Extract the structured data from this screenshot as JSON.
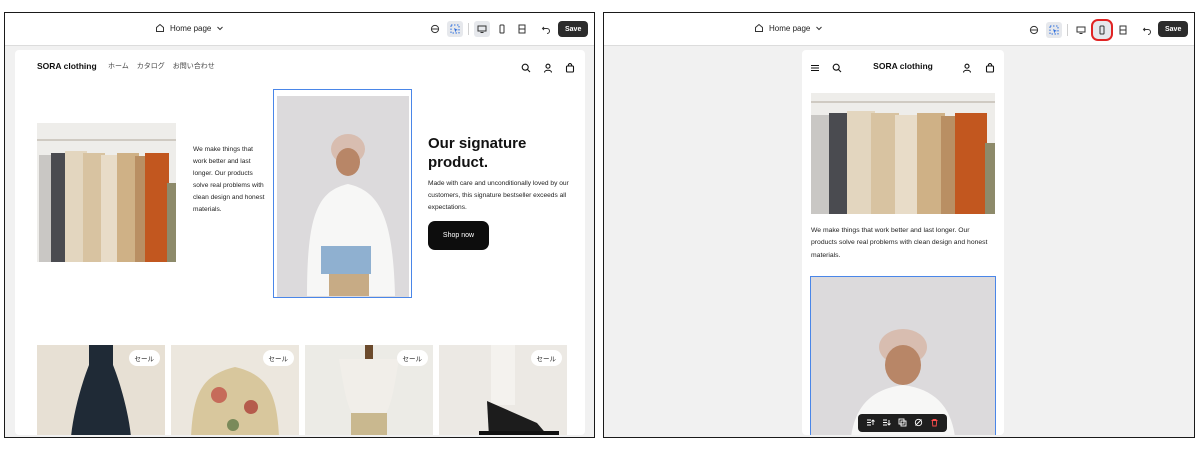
{
  "left_editor": {
    "page_selector": "Home page",
    "save_label": "Save",
    "store": {
      "brand": "SORA clothing",
      "nav": [
        "ホーム",
        "カタログ",
        "お問い合わせ"
      ],
      "tagline": "We make things that work better and last longer. Our products solve real problems with clean design and honest materials.",
      "signature_title": "Our signature product.",
      "signature_desc": "Made with care and unconditionally loved by our customers, this signature bestseller exceeds all expectations.",
      "shop_button": "Shop now",
      "products": [
        {
          "badge": "セール"
        },
        {
          "badge": "セール"
        },
        {
          "badge": "セール"
        },
        {
          "badge": "セール"
        }
      ]
    }
  },
  "right_editor": {
    "page_selector": "Home page",
    "save_label": "Save",
    "store": {
      "brand": "SORA clothing",
      "tagline": "We make things that work better and last longer. Our products solve real problems with clean design and honest materials."
    }
  },
  "colors": {
    "accent_selection": "#4a86e8",
    "highlight": "#e02424",
    "button_dark": "#0d0d0d"
  }
}
